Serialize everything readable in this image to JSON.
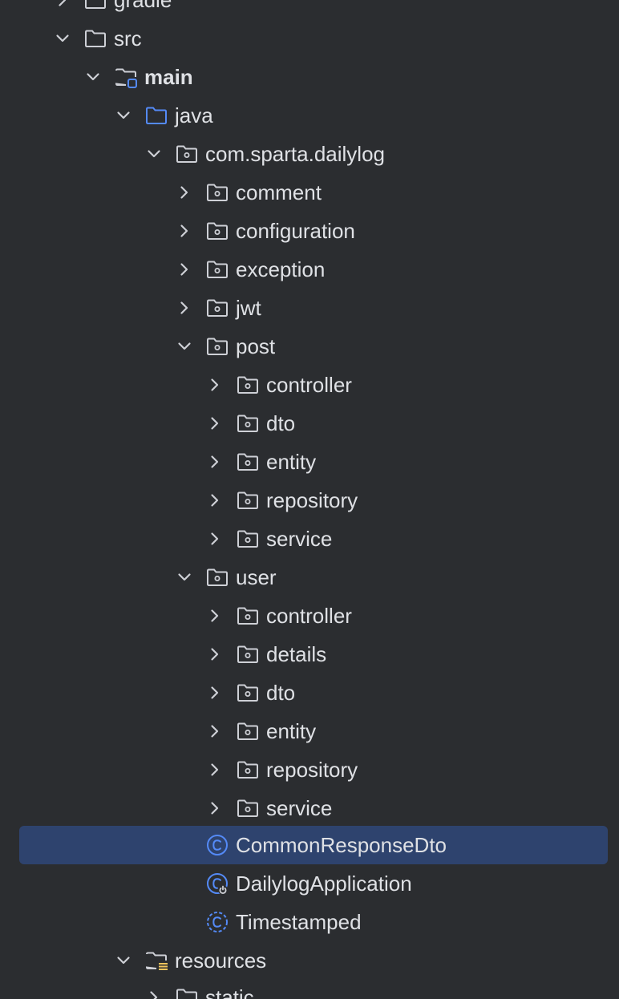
{
  "project_tree": {
    "items": [
      {
        "label": "gradle",
        "expanded": false,
        "icon": "folder-icon"
      },
      {
        "label": "src",
        "expanded": true,
        "icon": "folder-icon"
      },
      {
        "label": "main",
        "expanded": true,
        "icon": "source-root-folder-icon"
      },
      {
        "label": "java",
        "expanded": true,
        "icon": "java-source-folder-icon"
      },
      {
        "label": "com.sparta.dailylog",
        "expanded": true,
        "icon": "package-icon"
      },
      {
        "label": "comment",
        "expanded": false,
        "icon": "package-icon"
      },
      {
        "label": "configuration",
        "expanded": false,
        "icon": "package-icon"
      },
      {
        "label": "exception",
        "expanded": false,
        "icon": "package-icon"
      },
      {
        "label": "jwt",
        "expanded": false,
        "icon": "package-icon"
      },
      {
        "label": "post",
        "expanded": true,
        "icon": "package-icon"
      },
      {
        "label": "controller",
        "expanded": false,
        "icon": "package-icon"
      },
      {
        "label": "dto",
        "expanded": false,
        "icon": "package-icon"
      },
      {
        "label": "entity",
        "expanded": false,
        "icon": "package-icon"
      },
      {
        "label": "repository",
        "expanded": false,
        "icon": "package-icon"
      },
      {
        "label": "service",
        "expanded": false,
        "icon": "package-icon"
      },
      {
        "label": "user",
        "expanded": true,
        "icon": "package-icon"
      },
      {
        "label": "controller",
        "expanded": false,
        "icon": "package-icon"
      },
      {
        "label": "details",
        "expanded": false,
        "icon": "package-icon"
      },
      {
        "label": "dto",
        "expanded": false,
        "icon": "package-icon"
      },
      {
        "label": "entity",
        "expanded": false,
        "icon": "package-icon"
      },
      {
        "label": "repository",
        "expanded": false,
        "icon": "package-icon"
      },
      {
        "label": "service",
        "expanded": false,
        "icon": "package-icon"
      },
      {
        "label": "CommonResponseDto",
        "icon": "java-class-icon",
        "selected": true
      },
      {
        "label": "DailylogApplication",
        "icon": "spring-boot-class-icon"
      },
      {
        "label": "Timestamped",
        "icon": "java-class-icon"
      },
      {
        "label": "resources",
        "expanded": true,
        "icon": "resources-folder-icon"
      },
      {
        "label": "static",
        "expanded": false,
        "icon": "folder-icon"
      }
    ]
  },
  "colors": {
    "background": "#2b2d30",
    "text": "#dfe1e5",
    "icon": "#ced0d6",
    "selection": "#2e436e",
    "java_accent": "#548af7",
    "resources_accent": "#f2c55c"
  }
}
